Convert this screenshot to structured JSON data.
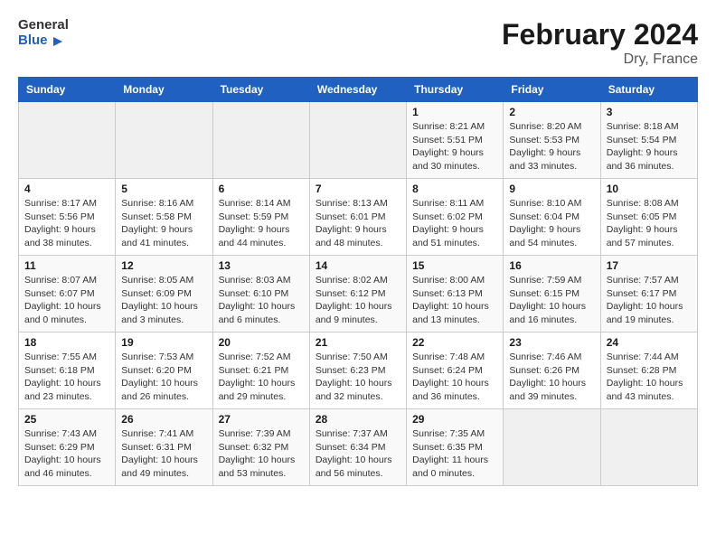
{
  "header": {
    "logo_general": "General",
    "logo_blue": "Blue",
    "month_title": "February 2024",
    "location": "Dry, France"
  },
  "calendar": {
    "columns": [
      "Sunday",
      "Monday",
      "Tuesday",
      "Wednesday",
      "Thursday",
      "Friday",
      "Saturday"
    ],
    "rows": [
      [
        {
          "day": "",
          "info": ""
        },
        {
          "day": "",
          "info": ""
        },
        {
          "day": "",
          "info": ""
        },
        {
          "day": "",
          "info": ""
        },
        {
          "day": "1",
          "info": "Sunrise: 8:21 AM\nSunset: 5:51 PM\nDaylight: 9 hours\nand 30 minutes."
        },
        {
          "day": "2",
          "info": "Sunrise: 8:20 AM\nSunset: 5:53 PM\nDaylight: 9 hours\nand 33 minutes."
        },
        {
          "day": "3",
          "info": "Sunrise: 8:18 AM\nSunset: 5:54 PM\nDaylight: 9 hours\nand 36 minutes."
        }
      ],
      [
        {
          "day": "4",
          "info": "Sunrise: 8:17 AM\nSunset: 5:56 PM\nDaylight: 9 hours\nand 38 minutes."
        },
        {
          "day": "5",
          "info": "Sunrise: 8:16 AM\nSunset: 5:58 PM\nDaylight: 9 hours\nand 41 minutes."
        },
        {
          "day": "6",
          "info": "Sunrise: 8:14 AM\nSunset: 5:59 PM\nDaylight: 9 hours\nand 44 minutes."
        },
        {
          "day": "7",
          "info": "Sunrise: 8:13 AM\nSunset: 6:01 PM\nDaylight: 9 hours\nand 48 minutes."
        },
        {
          "day": "8",
          "info": "Sunrise: 8:11 AM\nSunset: 6:02 PM\nDaylight: 9 hours\nand 51 minutes."
        },
        {
          "day": "9",
          "info": "Sunrise: 8:10 AM\nSunset: 6:04 PM\nDaylight: 9 hours\nand 54 minutes."
        },
        {
          "day": "10",
          "info": "Sunrise: 8:08 AM\nSunset: 6:05 PM\nDaylight: 9 hours\nand 57 minutes."
        }
      ],
      [
        {
          "day": "11",
          "info": "Sunrise: 8:07 AM\nSunset: 6:07 PM\nDaylight: 10 hours\nand 0 minutes."
        },
        {
          "day": "12",
          "info": "Sunrise: 8:05 AM\nSunset: 6:09 PM\nDaylight: 10 hours\nand 3 minutes."
        },
        {
          "day": "13",
          "info": "Sunrise: 8:03 AM\nSunset: 6:10 PM\nDaylight: 10 hours\nand 6 minutes."
        },
        {
          "day": "14",
          "info": "Sunrise: 8:02 AM\nSunset: 6:12 PM\nDaylight: 10 hours\nand 9 minutes."
        },
        {
          "day": "15",
          "info": "Sunrise: 8:00 AM\nSunset: 6:13 PM\nDaylight: 10 hours\nand 13 minutes."
        },
        {
          "day": "16",
          "info": "Sunrise: 7:59 AM\nSunset: 6:15 PM\nDaylight: 10 hours\nand 16 minutes."
        },
        {
          "day": "17",
          "info": "Sunrise: 7:57 AM\nSunset: 6:17 PM\nDaylight: 10 hours\nand 19 minutes."
        }
      ],
      [
        {
          "day": "18",
          "info": "Sunrise: 7:55 AM\nSunset: 6:18 PM\nDaylight: 10 hours\nand 23 minutes."
        },
        {
          "day": "19",
          "info": "Sunrise: 7:53 AM\nSunset: 6:20 PM\nDaylight: 10 hours\nand 26 minutes."
        },
        {
          "day": "20",
          "info": "Sunrise: 7:52 AM\nSunset: 6:21 PM\nDaylight: 10 hours\nand 29 minutes."
        },
        {
          "day": "21",
          "info": "Sunrise: 7:50 AM\nSunset: 6:23 PM\nDaylight: 10 hours\nand 32 minutes."
        },
        {
          "day": "22",
          "info": "Sunrise: 7:48 AM\nSunset: 6:24 PM\nDaylight: 10 hours\nand 36 minutes."
        },
        {
          "day": "23",
          "info": "Sunrise: 7:46 AM\nSunset: 6:26 PM\nDaylight: 10 hours\nand 39 minutes."
        },
        {
          "day": "24",
          "info": "Sunrise: 7:44 AM\nSunset: 6:28 PM\nDaylight: 10 hours\nand 43 minutes."
        }
      ],
      [
        {
          "day": "25",
          "info": "Sunrise: 7:43 AM\nSunset: 6:29 PM\nDaylight: 10 hours\nand 46 minutes."
        },
        {
          "day": "26",
          "info": "Sunrise: 7:41 AM\nSunset: 6:31 PM\nDaylight: 10 hours\nand 49 minutes."
        },
        {
          "day": "27",
          "info": "Sunrise: 7:39 AM\nSunset: 6:32 PM\nDaylight: 10 hours\nand 53 minutes."
        },
        {
          "day": "28",
          "info": "Sunrise: 7:37 AM\nSunset: 6:34 PM\nDaylight: 10 hours\nand 56 minutes."
        },
        {
          "day": "29",
          "info": "Sunrise: 7:35 AM\nSunset: 6:35 PM\nDaylight: 11 hours\nand 0 minutes."
        },
        {
          "day": "",
          "info": ""
        },
        {
          "day": "",
          "info": ""
        }
      ]
    ]
  }
}
